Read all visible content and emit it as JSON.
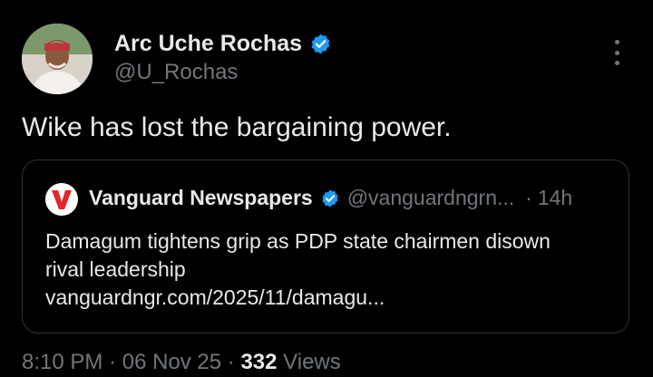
{
  "author": {
    "name": "Arc Uche Rochas",
    "handle": "@U_Rochas"
  },
  "tweet": {
    "text": "Wike has lost the bargaining power."
  },
  "quoted": {
    "name": "Vanguard Newspapers",
    "handle": "@vanguardngrn...",
    "separator": "·",
    "time": "14h",
    "headline_line1": "Damagum tightens grip as PDP state chairmen disown",
    "headline_line2": "rival leadership",
    "link": "vanguardngr.com/2025/11/damagu...",
    "logo_letter": "V",
    "logo_color": "#e3262c"
  },
  "meta": {
    "time": "8:10 PM",
    "sep1": " · ",
    "date": "06 Nov 25",
    "sep2": " · ",
    "views_count": "332",
    "views_label": " Views"
  },
  "colors": {
    "background": "#000000",
    "text": "#e7e9ea",
    "secondary": "#71767b",
    "verified": "#1d9bf0",
    "border": "#2f3336"
  },
  "icons": {
    "verified": "verified-badge-icon",
    "more": "more-options-icon"
  }
}
